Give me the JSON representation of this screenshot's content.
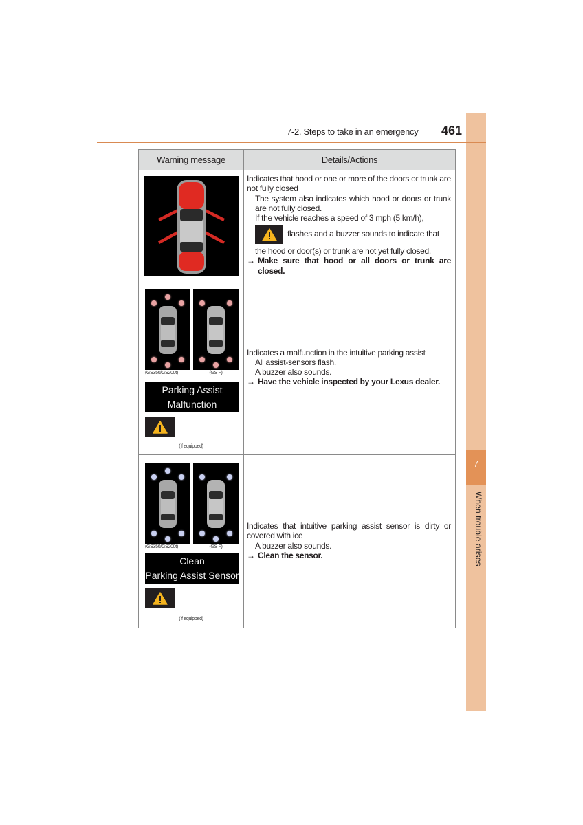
{
  "header": {
    "section": "7-2. Steps to take in an emergency",
    "page_number": "461"
  },
  "side_tab": {
    "chapter_number": "7",
    "chapter_title": "When trouble arises"
  },
  "colors": {
    "accent": "#d98a52",
    "tab_light": "#efc29e",
    "tab_dark": "#e39257",
    "header_cell_bg": "#dcdddd"
  },
  "table": {
    "headers": [
      "Warning message",
      "Details/Actions"
    ],
    "rows": [
      {
        "image": "door-open-car-icon",
        "details": {
          "main": "Indicates that hood or one or more of the doors or trunk are not fully closed",
          "sub1": "The system also indicates which hood or doors or trunk are not fully closed.",
          "sub2": "If the vehicle reaches a speed of 3 mph (5 km/h),",
          "sub3_after_icon": "flashes and a buzzer sounds to indicate that",
          "sub4": "the hood or door(s) or trunk are not yet fully closed.",
          "action_arrow": "→",
          "action": "Make sure that hood or all doors or trunk are closed."
        }
      },
      {
        "image_captions": [
          "(GS350/GS200t)",
          "(GS F)"
        ],
        "display_message": [
          "Parking Assist",
          "Malfunction"
        ],
        "if_equipped": "(If equipped)",
        "details": {
          "main": "Indicates a malfunction in the intuitive parking assist",
          "sub1": "All assist-sensors flash.",
          "sub2": "A buzzer also sounds.",
          "action_arrow": "→",
          "action": "Have the vehicle inspected by your Lexus dealer."
        }
      },
      {
        "image_captions": [
          "(GS350/GS200t)",
          "(GS F)"
        ],
        "display_message": [
          "Clean",
          "Parking Assist Sensor"
        ],
        "if_equipped": "(If equipped)",
        "details": {
          "main": "Indicates that intuitive parking assist sensor is dirty or covered with ice",
          "sub1": "A buzzer also sounds.",
          "action_arrow": "→",
          "action": "Clean the sensor."
        }
      }
    ]
  }
}
